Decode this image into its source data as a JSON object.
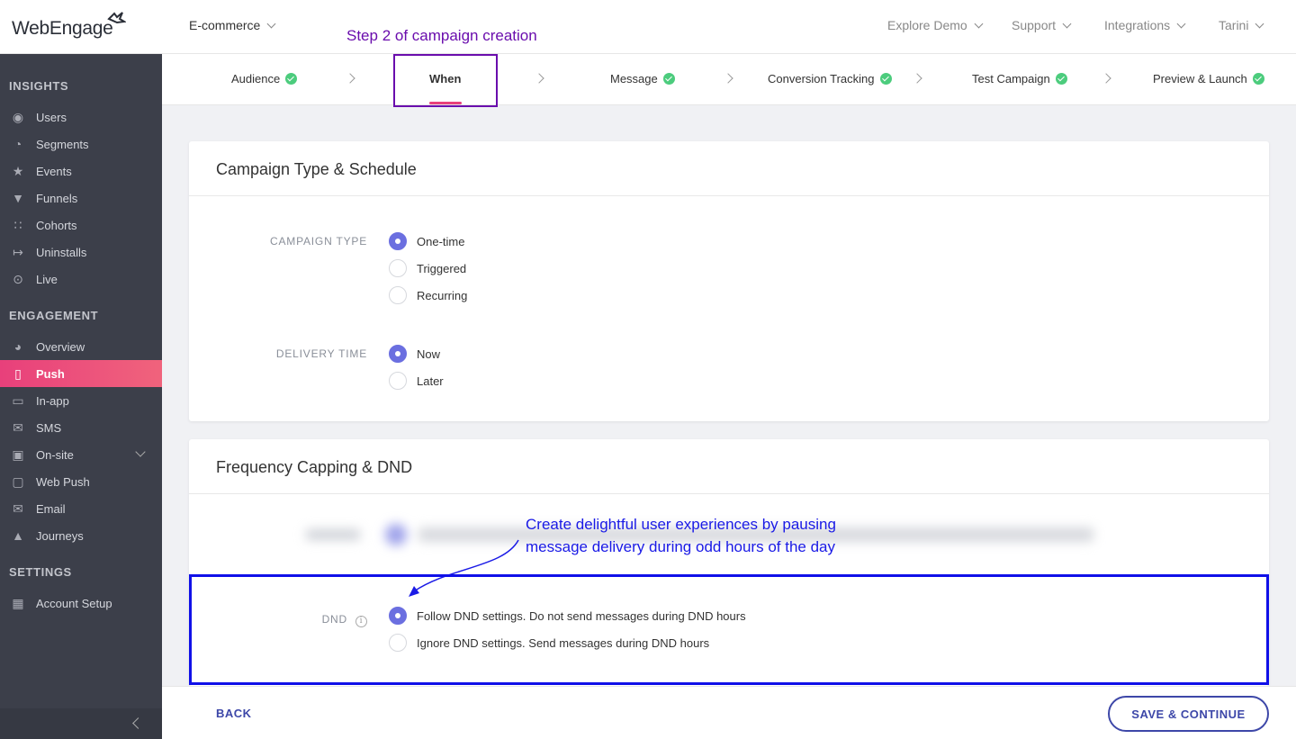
{
  "brand": {
    "logo_text": "WebEngage"
  },
  "header": {
    "project": "E-commerce",
    "nav": [
      "Explore Demo",
      "Support",
      "Integrations",
      "Tarini"
    ]
  },
  "annotations": {
    "step_note": "Step 2 of campaign creation",
    "dnd_note": "Create delightful user experiences by pausing\nmessage delivery during odd hours of the day",
    "annotation_color": "#1a1ae6"
  },
  "sidebar": {
    "sections": [
      "INSIGHTS",
      "ENGAGEMENT",
      "SETTINGS"
    ],
    "insights": [
      {
        "label": "Users",
        "icon": "users-icon"
      },
      {
        "label": "Segments",
        "icon": "pie-chart-icon"
      },
      {
        "label": "Events",
        "icon": "star-icon"
      },
      {
        "label": "Funnels",
        "icon": "funnel-icon"
      },
      {
        "label": "Cohorts",
        "icon": "grid-icon"
      },
      {
        "label": "Uninstalls",
        "icon": "exit-icon"
      },
      {
        "label": "Live",
        "icon": "broadcast-icon"
      }
    ],
    "engagement": [
      {
        "label": "Overview",
        "icon": "eye-icon"
      },
      {
        "label": "Push",
        "icon": "mobile-push-icon",
        "active": true
      },
      {
        "label": "In-app",
        "icon": "in-app-icon"
      },
      {
        "label": "SMS",
        "icon": "chat-icon"
      },
      {
        "label": "On-site",
        "icon": "window-icon"
      },
      {
        "label": "Web Push",
        "icon": "browser-icon"
      },
      {
        "label": "Email",
        "icon": "envelope-icon"
      },
      {
        "label": "Journeys",
        "icon": "rocket-icon"
      }
    ],
    "settings": [
      {
        "label": "Account Setup",
        "icon": "dashboard-icon"
      }
    ]
  },
  "stepper": {
    "steps": [
      {
        "label": "Audience",
        "done": true
      },
      {
        "label": "When",
        "done": false,
        "current": true
      },
      {
        "label": "Message",
        "done": true
      },
      {
        "label": "Conversion Tracking",
        "done": true
      },
      {
        "label": "Test Campaign",
        "done": true
      },
      {
        "label": "Preview & Launch",
        "done": true
      }
    ]
  },
  "schedule_card": {
    "title": "Campaign Type & Schedule",
    "campaign_type": {
      "label": "CAMPAIGN TYPE",
      "options": [
        "One-time",
        "Triggered",
        "Recurring"
      ],
      "selected": "One-time"
    },
    "delivery_time": {
      "label": "DELIVERY TIME",
      "options": [
        "Now",
        "Later"
      ],
      "selected": "Now"
    }
  },
  "frequency_card": {
    "title": "Frequency Capping & DND",
    "dnd": {
      "label": "DND",
      "options": [
        "Follow DND settings. Do not send messages during DND hours",
        "Ignore DND settings. Send messages during DND hours"
      ],
      "selected": "Follow DND settings. Do not send messages during DND hours"
    }
  },
  "footer": {
    "back_label": "BACK",
    "save_label": "SAVE & CONTINUE"
  },
  "colors": {
    "accent": "#6b6fe0",
    "active_nav": "#e8407b",
    "primary_button": "#3d47a8",
    "success": "#4ccc7d"
  }
}
